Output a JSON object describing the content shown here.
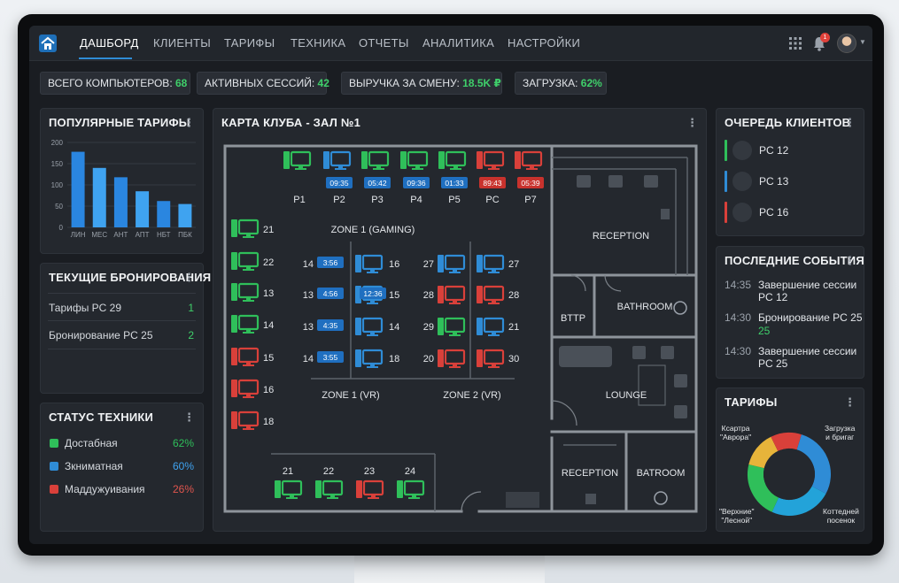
{
  "colors": {
    "green": "#2fbf5a",
    "blue": "#2f8cd6",
    "red": "#d9403a",
    "accent": "#2f8cd6",
    "chart_blue": "#2a86e0",
    "chart_blue_light": "#3fa3f0"
  },
  "nav": {
    "items": [
      "ДАШБОРД",
      "КЛИЕНТЫ",
      "ТАРИФЫ",
      "ТЕХНИКА",
      "ОТЧЕТЫ",
      "АНАЛИТИКА",
      "НАСТРОЙКИ"
    ],
    "notification_count": "1"
  },
  "stats": [
    {
      "label": "ВСЕГО КОМПЬЮТЕРОВ:",
      "value": "68"
    },
    {
      "label": "АКТИВНЫХ СЕССИЙ:",
      "value": "42"
    },
    {
      "label": "ВЫРУЧКА ЗА СМЕНУ:",
      "value": "18.5K ₽"
    },
    {
      "label": "ЗАГРУЗКА:",
      "value": "62%"
    }
  ],
  "popular_tariffs": {
    "title": "ПОПУЛЯРНЫЕ ТАРИФЫ",
    "chart_data": {
      "type": "bar",
      "categories": [
        "ЛИН",
        "МЕС",
        "АНТ",
        "АПТ",
        "НБТ",
        "ПБК"
      ],
      "values": [
        178,
        140,
        118,
        85,
        62,
        55
      ],
      "ylim": [
        0,
        200
      ],
      "yticks": [
        "0",
        "50",
        "100",
        "150",
        "200"
      ],
      "grid": true
    }
  },
  "bookings": {
    "title": "ТЕКУЩИЕ БРОНИРОВАНИЯ",
    "rows": [
      {
        "label": "Тарифы PC 29",
        "value": "1"
      },
      {
        "label": "Бронирование PC 25",
        "value": "2"
      }
    ]
  },
  "equipment": {
    "title": "СТАТУС ТЕХНИКИ",
    "rows": [
      {
        "label": "Достабная",
        "value": "62%",
        "color": "#2fbf5a"
      },
      {
        "label": "Зкниматная",
        "value": "60%",
        "color": "#2f8cd6"
      },
      {
        "label": "Маддужуивания",
        "value": "26%",
        "color": "#d9403a"
      }
    ]
  },
  "map": {
    "title": "КАРТА КЛУБА - ЗАЛ №1",
    "zones": {
      "gaming": "ZONE 1 (GAMING)",
      "vr1": "ZONE 1 (VR)",
      "vr2": "ZONE 2 (VR)"
    },
    "rooms": {
      "reception_top": "RECEPTION",
      "bttp": "BTTP",
      "bathroom": "BATHROOM",
      "lounge": "LOUNGE",
      "reception_bottom": "RECEPTION",
      "batroom": "BATROOM"
    },
    "top_row": [
      {
        "label": "P1",
        "status": "green",
        "timer": ""
      },
      {
        "label": "P2",
        "status": "blue",
        "timer": "09:35"
      },
      {
        "label": "P3",
        "status": "green",
        "timer": "05:42"
      },
      {
        "label": "P4",
        "status": "green",
        "timer": "09:36"
      },
      {
        "label": "P5",
        "status": "green",
        "timer": "01:33"
      },
      {
        "label": "PC",
        "status": "red",
        "timer": "89:43"
      },
      {
        "label": "P7",
        "status": "red",
        "timer": "05:39"
      }
    ],
    "left_col": [
      {
        "label": "21",
        "status": "green"
      },
      {
        "label": "22",
        "status": "green"
      },
      {
        "label": "13",
        "status": "green"
      },
      {
        "label": "14",
        "status": "green"
      },
      {
        "label": "15",
        "status": "red"
      },
      {
        "label": "16",
        "status": "red"
      },
      {
        "label": "18",
        "status": "red"
      }
    ],
    "vr1_left": [
      {
        "label": "14",
        "timer": "3:56"
      },
      {
        "label": "13",
        "timer": "4:56"
      },
      {
        "label": "13",
        "timer": "4:35"
      },
      {
        "label": "14",
        "timer": "3:55"
      }
    ],
    "vr1_right": [
      {
        "label": "16",
        "status": "blue",
        "timer": ""
      },
      {
        "label": "15",
        "status": "blue",
        "timer": "12:36"
      },
      {
        "label": "14",
        "status": "blue",
        "timer": ""
      },
      {
        "label": "18",
        "status": "blue",
        "timer": ""
      }
    ],
    "vr2_left": [
      {
        "label": "27",
        "status": "blue"
      },
      {
        "label": "28",
        "status": "red"
      },
      {
        "label": "29",
        "status": "green"
      },
      {
        "label": "20",
        "status": "red"
      }
    ],
    "vr2_right": [
      {
        "label": "27",
        "status": "blue"
      },
      {
        "label": "28",
        "status": "red"
      },
      {
        "label": "21",
        "status": "blue"
      },
      {
        "label": "30",
        "status": "red"
      }
    ],
    "bottom_row": [
      {
        "label": "21",
        "status": "green"
      },
      {
        "label": "22",
        "status": "green"
      },
      {
        "label": "23",
        "status": "red"
      },
      {
        "label": "24",
        "status": "green"
      }
    ]
  },
  "queue": {
    "title": "ОЧЕРЕДЬ КЛИЕНТОВ",
    "items": [
      {
        "label": "PC 12",
        "color": "#2fbf5a"
      },
      {
        "label": "PC 13",
        "color": "#2f8cd6"
      },
      {
        "label": "PC 16",
        "color": "#d9403a"
      }
    ]
  },
  "events": {
    "title": "ПОСЛЕДНИЕ СОБЫТИЯ",
    "items": [
      {
        "time": "14:35",
        "text": "Завершение сессии PC 12",
        "sub": ""
      },
      {
        "time": "14:30",
        "text": "Бронирование PC 25",
        "sub": "25"
      },
      {
        "time": "14:30",
        "text": "Завершение сессии PC 25",
        "sub": ""
      }
    ]
  },
  "tariffs_pie": {
    "title": "ТАРИФЫ",
    "chart_data": {
      "type": "pie",
      "categories": [
        "Загрузка и бригаг",
        "Коттедней посенок",
        "\"Верхние\" \"Лесной\"",
        "Ксартира \"Аврора\"",
        "Красный"
      ],
      "values": [
        28,
        24,
        22,
        14,
        12
      ],
      "colors": [
        "#2f8cd6",
        "#23a3d9",
        "#2fbf5a",
        "#e7b43a",
        "#d9403a"
      ],
      "legend_labels": [
        "Загрузка\nи бригаг",
        "Коттедней\nпосенок",
        "\"Верхние\"\n\"Лесной\"",
        "Ксартра\n\"Аврора\""
      ]
    }
  }
}
